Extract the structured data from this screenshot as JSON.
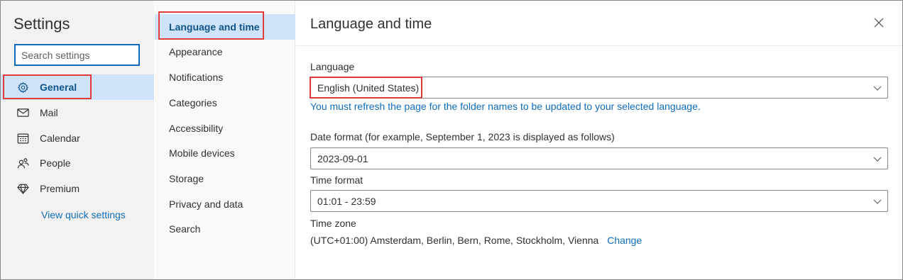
{
  "sidebar": {
    "title": "Settings",
    "search_placeholder": "Search settings",
    "items": [
      {
        "label": "General",
        "icon": "gear-icon"
      },
      {
        "label": "Mail",
        "icon": "mail-icon"
      },
      {
        "label": "Calendar",
        "icon": "calendar-icon"
      },
      {
        "label": "People",
        "icon": "people-icon"
      },
      {
        "label": "Premium",
        "icon": "diamond-icon"
      }
    ],
    "quick_settings_link": "View quick settings"
  },
  "subnav": {
    "items": [
      "Language and time",
      "Appearance",
      "Notifications",
      "Categories",
      "Accessibility",
      "Mobile devices",
      "Storage",
      "Privacy and data",
      "Search"
    ]
  },
  "panel": {
    "title": "Language and time",
    "language": {
      "label": "Language",
      "value": "English (United States)",
      "note": "You must refresh the page for the folder names to be updated to your selected language."
    },
    "date_format": {
      "label": "Date format (for example, September 1, 2023 is displayed as follows)",
      "value": "2023-09-01"
    },
    "time_format": {
      "label": "Time format",
      "value": "01:01 - 23:59"
    },
    "time_zone": {
      "label": "Time zone",
      "value": "(UTC+01:00) Amsterdam, Berlin, Bern, Rome, Stockholm, Vienna",
      "change_link": "Change"
    }
  },
  "colors": {
    "accent": "#0f6cbd",
    "selected_bg": "#cfe4fa",
    "highlight_box": "#e03c3c"
  }
}
